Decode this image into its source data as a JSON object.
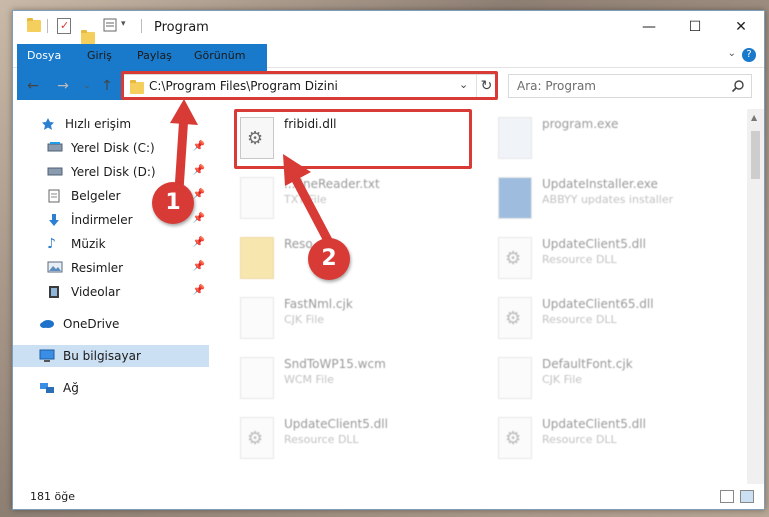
{
  "window": {
    "title": "Program",
    "minimize": "—",
    "maximize": "☐",
    "close": "✕"
  },
  "ribbon": {
    "tabs": [
      "Dosya",
      "Giriş",
      "Paylaş",
      "Görünüm"
    ],
    "help": "?"
  },
  "address": {
    "path": "C:\\Program Files\\Program Dizini",
    "search_placeholder": "Ara: Program"
  },
  "sidebar": {
    "items": [
      {
        "label": "Hızlı erişim",
        "icon": "star-icon",
        "pinned": false
      },
      {
        "label": "Yerel Disk (C:)",
        "icon": "drive-icon",
        "pinned": true
      },
      {
        "label": "Yerel Disk (D:)",
        "icon": "drive-icon",
        "pinned": true
      },
      {
        "label": "Belgeler",
        "icon": "documents-icon",
        "pinned": true
      },
      {
        "label": "İndirmeler",
        "icon": "download-icon",
        "pinned": true
      },
      {
        "label": "Müzik",
        "icon": "music-icon",
        "pinned": true
      },
      {
        "label": "Resimler",
        "icon": "pictures-icon",
        "pinned": true
      },
      {
        "label": "Videolar",
        "icon": "videos-icon",
        "pinned": true
      },
      {
        "label": "OneDrive",
        "icon": "cloud-icon",
        "pinned": false
      },
      {
        "label": "Bu bilgisayar",
        "icon": "computer-icon",
        "pinned": false,
        "selected": true
      },
      {
        "label": "Ağ",
        "icon": "network-icon",
        "pinned": false
      }
    ]
  },
  "files": [
    {
      "name": "fribidi.dll",
      "type": ""
    },
    {
      "name": "program.exe",
      "type": ""
    },
    {
      "name": "...fineReader.txt",
      "type": "TXT File"
    },
    {
      "name": "UpdateInstaller.exe",
      "type": "ABBYY updates installer"
    },
    {
      "name": "Reso...",
      "type": ""
    },
    {
      "name": "UpdateClient5.dll",
      "type": "Resource DLL"
    },
    {
      "name": "FastNml.cjk",
      "type": "CJK File"
    },
    {
      "name": "UpdateClient65.dll",
      "type": "Resource DLL"
    },
    {
      "name": "SndToWP15.wcm",
      "type": "WCM File"
    },
    {
      "name": "DefaultFont.cjk",
      "type": "CJK File"
    },
    {
      "name": "UpdateClient5.dll",
      "type": "Resource DLL"
    },
    {
      "name": "UpdateClient5.dll",
      "type": "Resource DLL"
    }
  ],
  "status": {
    "count": "181 öğe"
  },
  "callouts": [
    "1",
    "2"
  ],
  "colors": {
    "accent": "#1979ca",
    "highlight": "#d83a35",
    "selected_bg": "#cce0f4"
  }
}
